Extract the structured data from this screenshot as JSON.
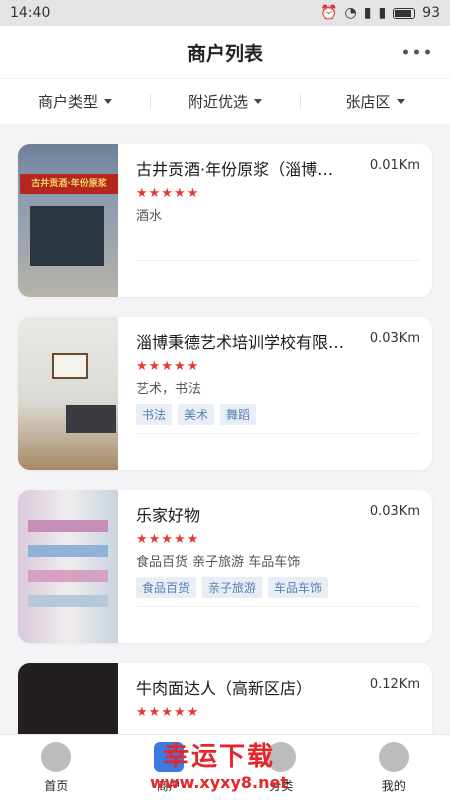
{
  "status_bar": {
    "time": "14:40",
    "battery": "93"
  },
  "header": {
    "title": "商户列表"
  },
  "filters": [
    {
      "label": "商户类型"
    },
    {
      "label": "附近优选"
    },
    {
      "label": "张店区"
    }
  ],
  "merchants": [
    {
      "name": "古井贡酒·年份原浆（淄博…",
      "distance": "0.01Km",
      "rating": 5,
      "stars": "★★★★★",
      "category": "酒水",
      "tags": [],
      "thumb_sign": "古井贡酒·年份原浆"
    },
    {
      "name": "淄博秉德艺术培训学校有限…",
      "distance": "0.03Km",
      "rating": 5,
      "stars": "★★★★★",
      "category": "艺术，书法",
      "tags": [
        "书法",
        "美术",
        "舞蹈"
      ]
    },
    {
      "name": "乐家好物",
      "distance": "0.03Km",
      "rating": 5,
      "stars": "★★★★★",
      "category": "食品百货 亲子旅游 车品车饰",
      "tags": [
        "食品百货",
        "亲子旅游",
        "车品车饰"
      ]
    },
    {
      "name": "牛肉面达人（高新区店）",
      "distance": "0.12Km",
      "rating": 5,
      "stars": "★★★★★",
      "category": "",
      "tags": []
    }
  ],
  "tabbar": [
    {
      "label": "首页",
      "icon": "car-icon"
    },
    {
      "label": "商户",
      "icon": "shop-icon"
    },
    {
      "label": "分类",
      "icon": "category-icon"
    },
    {
      "label": "我的",
      "icon": "user-icon"
    }
  ],
  "watermark": {
    "line1": "幸运下载",
    "line2": "www.xyxy8.net"
  },
  "colors": {
    "star": "#e53935",
    "tag_text": "#5a7fb0",
    "tag_bg": "#e8eef6",
    "accent": "#3b7be0"
  }
}
